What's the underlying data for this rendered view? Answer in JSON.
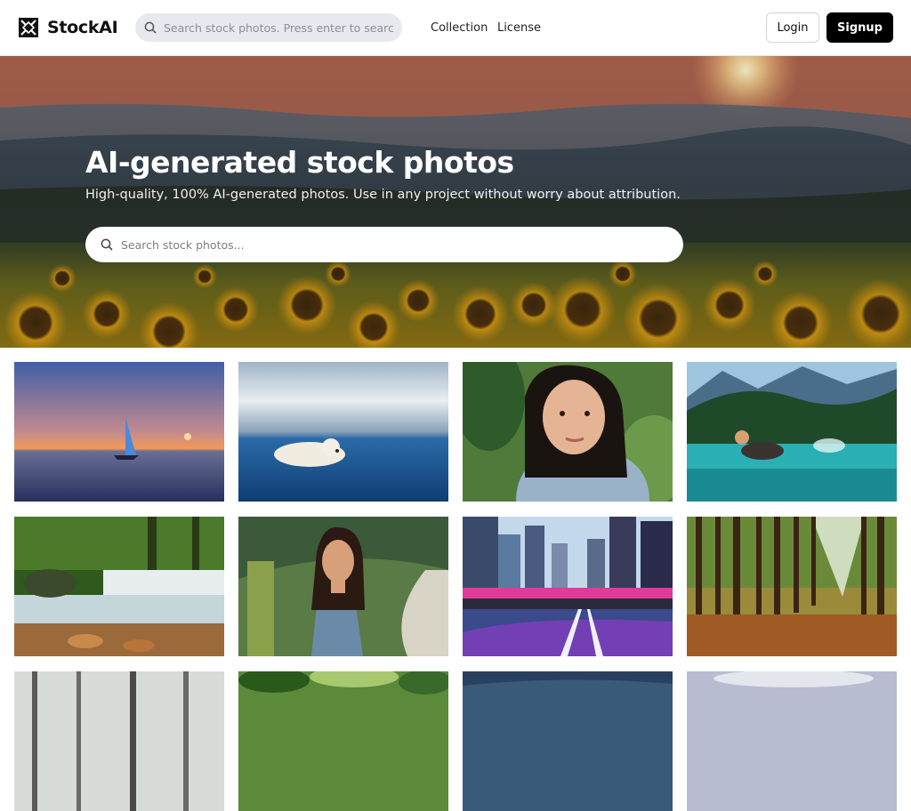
{
  "header": {
    "brand": "StockAI",
    "search_placeholder": "Search stock photos. Press enter to search.",
    "nav": [
      "Collection",
      "License"
    ],
    "login_label": "Login",
    "signup_label": "Signup"
  },
  "hero": {
    "title": "AI-generated stock photos",
    "subtitle": "High-quality, 100% AI-generated photos. Use in any project without worry about attribution.",
    "search_placeholder": "Search stock photos..."
  },
  "icons": {
    "brand_logo": "stockai-logo-icon",
    "search": "search-icon"
  },
  "colors": {
    "primary_button": "#000000",
    "search_bg": "#e7e9ee"
  },
  "photos": [
    "sailboat-sunset",
    "polar-bear-ocean",
    "woman-portrait-leaves",
    "husky-in-lake",
    "forest-waterfall",
    "woman-blue-dress-trail",
    "city-street-neon",
    "pine-forest",
    "misty-birch-forest",
    "green-foliage",
    "blue-dunes",
    "cloudy-sky"
  ]
}
